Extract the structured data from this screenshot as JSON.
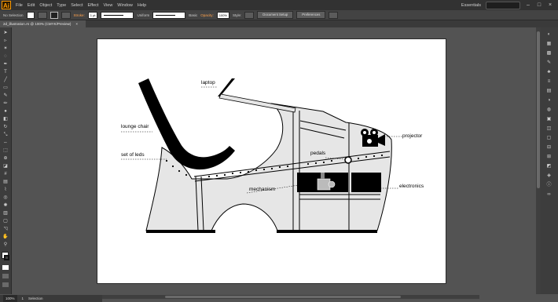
{
  "app": {
    "logo": "Ai",
    "workspace": "Essentials"
  },
  "menu": [
    "File",
    "Edit",
    "Object",
    "Type",
    "Select",
    "Effect",
    "View",
    "Window",
    "Help"
  ],
  "controlbar": {
    "selection": "No Selection",
    "stroke_label": "Stroke:",
    "stroke_weight": "1 pt",
    "profile": "Uniform",
    "brush": "Basic",
    "opacity_label": "Opacity:",
    "opacity_value": "100%",
    "style_label": "Style:",
    "document_setup": "Document Setup",
    "preferences": "Preferences"
  },
  "document": {
    "tab": "2d_illustration.AI @ 100% (CMYK/Preview)",
    "close": "×"
  },
  "status": {
    "zoom": "100%",
    "page": "1",
    "tool": "Selection"
  },
  "illustration": {
    "labels": {
      "laptop": "laptop",
      "lounge_chair": "lounge chair",
      "set_of_leds": "set of leds",
      "pedals": "pedals",
      "projector": "projector",
      "mechanism": "mechanism",
      "electronics": "electronics"
    },
    "colors": {
      "fill": "#e6e6e6",
      "black": "#000000"
    }
  },
  "tools": [
    "arrow-icon",
    "direct-select-icon",
    "magic-wand-icon",
    "lasso-icon",
    "pen-icon",
    "type-icon",
    "line-icon",
    "rectangle-icon",
    "paintbrush-icon",
    "pencil-icon",
    "blob-brush-icon",
    "eraser-icon",
    "rotate-icon",
    "scale-icon",
    "width-icon",
    "free-transform-icon",
    "shape-builder-icon",
    "perspective-icon",
    "mesh-icon",
    "gradient-icon",
    "eyedropper-icon",
    "blend-icon",
    "symbol-sprayer-icon",
    "graph-icon",
    "artboard-icon",
    "slice-icon",
    "hand-icon",
    "zoom-icon"
  ],
  "dock": [
    "color-panel-icon",
    "color-guide-icon",
    "swatches-icon",
    "brushes-icon",
    "symbols-icon",
    "stroke-icon",
    "gradient-panel-icon",
    "transparency-icon",
    "appearance-icon",
    "graphic-styles-icon",
    "layers-icon",
    "artboards-icon",
    "align-icon",
    "transform-icon",
    "pathfinder-icon",
    "navigator-icon",
    "info-icon",
    "links-icon"
  ]
}
